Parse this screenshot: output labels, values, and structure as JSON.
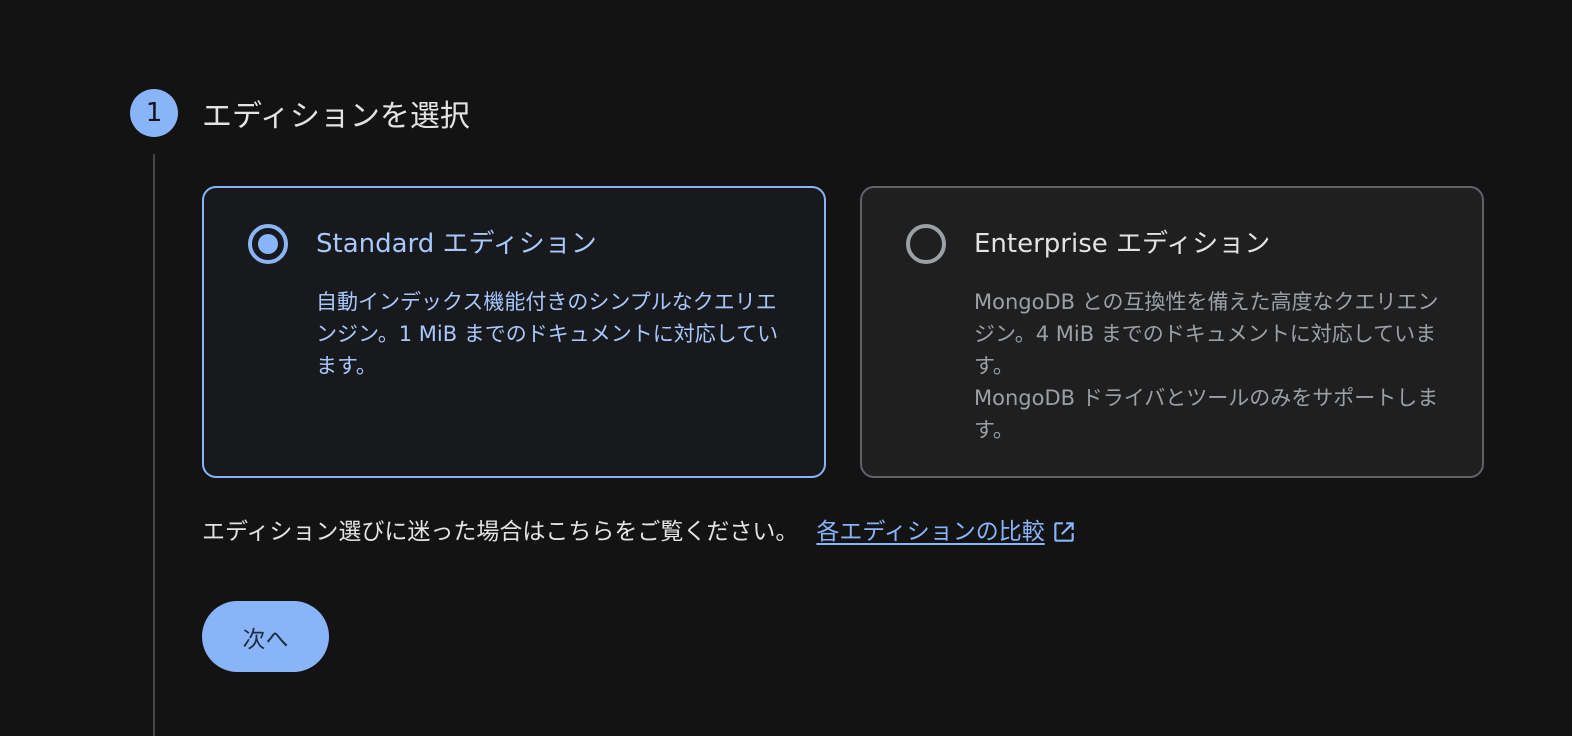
{
  "step": {
    "number": "1",
    "title": "エディションを選択"
  },
  "editions": {
    "standard": {
      "title": "Standard エディション",
      "description": "自動インデックス機能付きのシンプルなクエリエンジン。1 MiB までのドキュメントに対応しています。",
      "selected": true
    },
    "enterprise": {
      "title": "Enterprise エディション",
      "description_line1": "MongoDB との互換性を備えた高度なクエリエンジン。4 MiB までのドキュメントに対応しています。",
      "description_line2": "MongoDB ドライバとツールのみをサポートします。",
      "selected": false
    }
  },
  "help": {
    "text": "エディション選びに迷った場合はこちらをご覧ください。",
    "link_label": "各エディションの比較",
    "link_icon": "open-in-new-icon"
  },
  "actions": {
    "next_label": "次へ"
  },
  "colors": {
    "accent": "#8ab4f8",
    "background": "#131314",
    "selected_card_border": "#8ab4f8",
    "unselected_card_border": "#5f6368"
  }
}
